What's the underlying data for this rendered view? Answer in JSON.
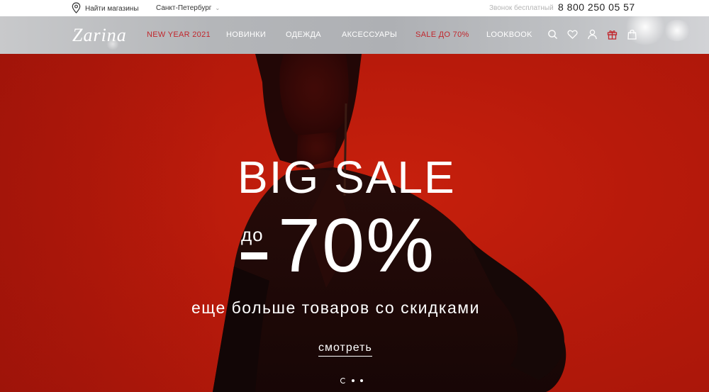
{
  "topbar": {
    "find_stores": "Найти магазины",
    "city": "Санкт-Петербург",
    "free_call": "Звонок бесплатный",
    "phone": "8 800 250 05 57"
  },
  "brand": {
    "logo": "Zarina"
  },
  "nav": {
    "items": [
      {
        "label": "NEW YEAR 2021",
        "highlight": true
      },
      {
        "label": "НОВИНКИ",
        "highlight": false
      },
      {
        "label": "ОДЕЖДА",
        "highlight": false
      },
      {
        "label": "АКСЕССУАРЫ",
        "highlight": false
      },
      {
        "label": "SALE ДО 70%",
        "highlight": true
      },
      {
        "label": "LOOKBOOK",
        "highlight": false
      }
    ],
    "icons": [
      "search-icon",
      "heart-icon",
      "user-icon",
      "gift-icon",
      "bag-icon"
    ]
  },
  "hero": {
    "title": "BIG SALE",
    "prefix": "до",
    "discount": "70%",
    "subtitle": "еще больше товаров со скидками",
    "cta": "смотреть",
    "slides_total": 3,
    "slide_active": 1
  },
  "colors": {
    "accent_red": "#c1272d",
    "hero_bg": "#b81a0b"
  }
}
